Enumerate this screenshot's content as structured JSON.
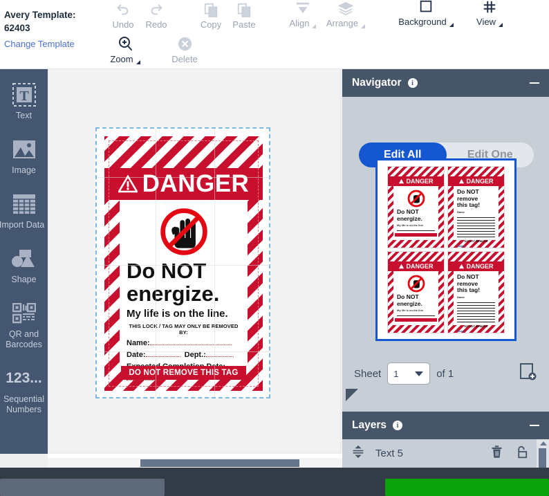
{
  "toolbar": {
    "template_label": "Avery Template:",
    "template_number": "62403",
    "change_template": "Change Template",
    "items": [
      {
        "label": "Undo",
        "icon": "undo-icon",
        "enabled": false,
        "caret": false
      },
      {
        "label": "Redo",
        "icon": "redo-icon",
        "enabled": false,
        "caret": false
      },
      {
        "label": "Copy",
        "icon": "copy-icon",
        "enabled": false,
        "caret": false
      },
      {
        "label": "Paste",
        "icon": "paste-icon",
        "enabled": false,
        "caret": false
      },
      {
        "label": "Align",
        "icon": "align-icon",
        "enabled": false,
        "caret": true
      },
      {
        "label": "Arrange",
        "icon": "arrange-icon",
        "enabled": false,
        "caret": true
      },
      {
        "label": "Background",
        "icon": "background-icon",
        "enabled": true,
        "caret": true
      },
      {
        "label": "View",
        "icon": "grid-view-icon",
        "enabled": true,
        "caret": true
      },
      {
        "label": "Zoom",
        "icon": "zoom-in-icon",
        "enabled": true,
        "caret": true
      },
      {
        "label": "Delete",
        "icon": "delete-circle-icon",
        "enabled": false,
        "caret": false
      }
    ]
  },
  "sidebar": {
    "items": [
      {
        "label": "Text",
        "icon": "text-tool-icon"
      },
      {
        "label": "Image",
        "icon": "image-tool-icon"
      },
      {
        "label": "Import Data",
        "icon": "import-data-icon"
      },
      {
        "label": "Shape",
        "icon": "shape-tool-icon"
      },
      {
        "label": "QR and Barcodes",
        "icon": "qr-barcode-icon"
      },
      {
        "label": "Sequential Numbers",
        "icon": "sequential-numbers-icon"
      }
    ],
    "sequential_glyph": "123..."
  },
  "label": {
    "heading": "DANGER",
    "line1": "Do NOT",
    "line2": "energize.",
    "line3": "My life is on the line.",
    "removed_by": "THIS LOCK / TAG MAY ONLY BE REMOVED BY:",
    "field_name": "Name:",
    "field_date": "Date:",
    "field_dept": "Dept.:",
    "field_expected": "Expected Completion Date:",
    "footer": "DO NOT REMOVE THIS TAG",
    "colors": {
      "red": "#c8102e",
      "black": "#111111",
      "white": "#ffffff"
    }
  },
  "navigator": {
    "title": "Navigator",
    "info_glyph": "i",
    "edit_all": "Edit All",
    "edit_one": "Edit One",
    "active_segment": "Edit All",
    "accent": "#1457d1",
    "sheet_label": "Sheet",
    "sheet_value": "1",
    "sheet_of": "of 1",
    "thumbnails": [
      {
        "type": "front",
        "heading": "DANGER",
        "line1": "Do NOT",
        "line2": "energize.",
        "sub": "My life is on the line.",
        "selected": true
      },
      {
        "type": "back",
        "heading": "DANGER",
        "line1": "Do NOT remove",
        "line2": "this tag!",
        "selected": false
      },
      {
        "type": "front",
        "heading": "DANGER",
        "line1": "Do NOT",
        "line2": "energize.",
        "sub": "My life is on the line.",
        "selected": false
      },
      {
        "type": "back",
        "heading": "DANGER",
        "line1": "Do NOT remove",
        "line2": "this tag!",
        "selected": false
      }
    ]
  },
  "layers": {
    "title": "Layers",
    "info_glyph": "i",
    "rows": [
      {
        "name": "Text 5",
        "delete_icon": "trash-icon",
        "lock_icon": "unlock-icon"
      }
    ]
  }
}
